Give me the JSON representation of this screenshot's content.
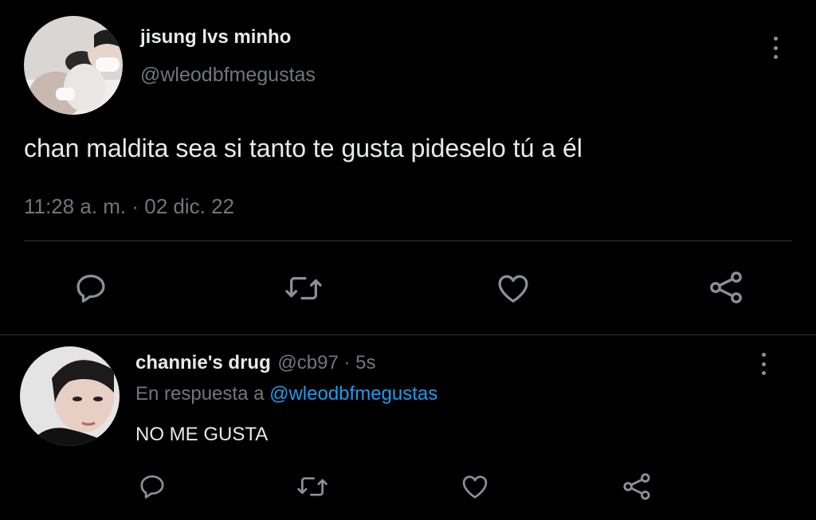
{
  "tweet": {
    "display_name": "jisung lvs minho",
    "handle": "@wleodbfmegustas",
    "text": "chan maldita sea si tanto te gusta pideselo tú a él",
    "timestamp": "11:28 a. m. · 02 dic. 22",
    "avatar_icon": "user-avatar-photo"
  },
  "reply": {
    "display_name": "channie's drug",
    "handle_time": "@cb97 · 5s",
    "replying_prefix": "En respuesta a",
    "replying_to": "@wleodbfmegustas",
    "text": "NO ME GUSTA",
    "avatar_icon": "user-avatar-photo"
  },
  "actions": [
    "reply-icon",
    "retweet-icon",
    "like-icon",
    "share-icon"
  ],
  "colors": {
    "background": "#000000",
    "text": "#e7e9ea",
    "secondary": "#71767b",
    "link": "#1d9bf0",
    "divider": "#2f3336"
  }
}
